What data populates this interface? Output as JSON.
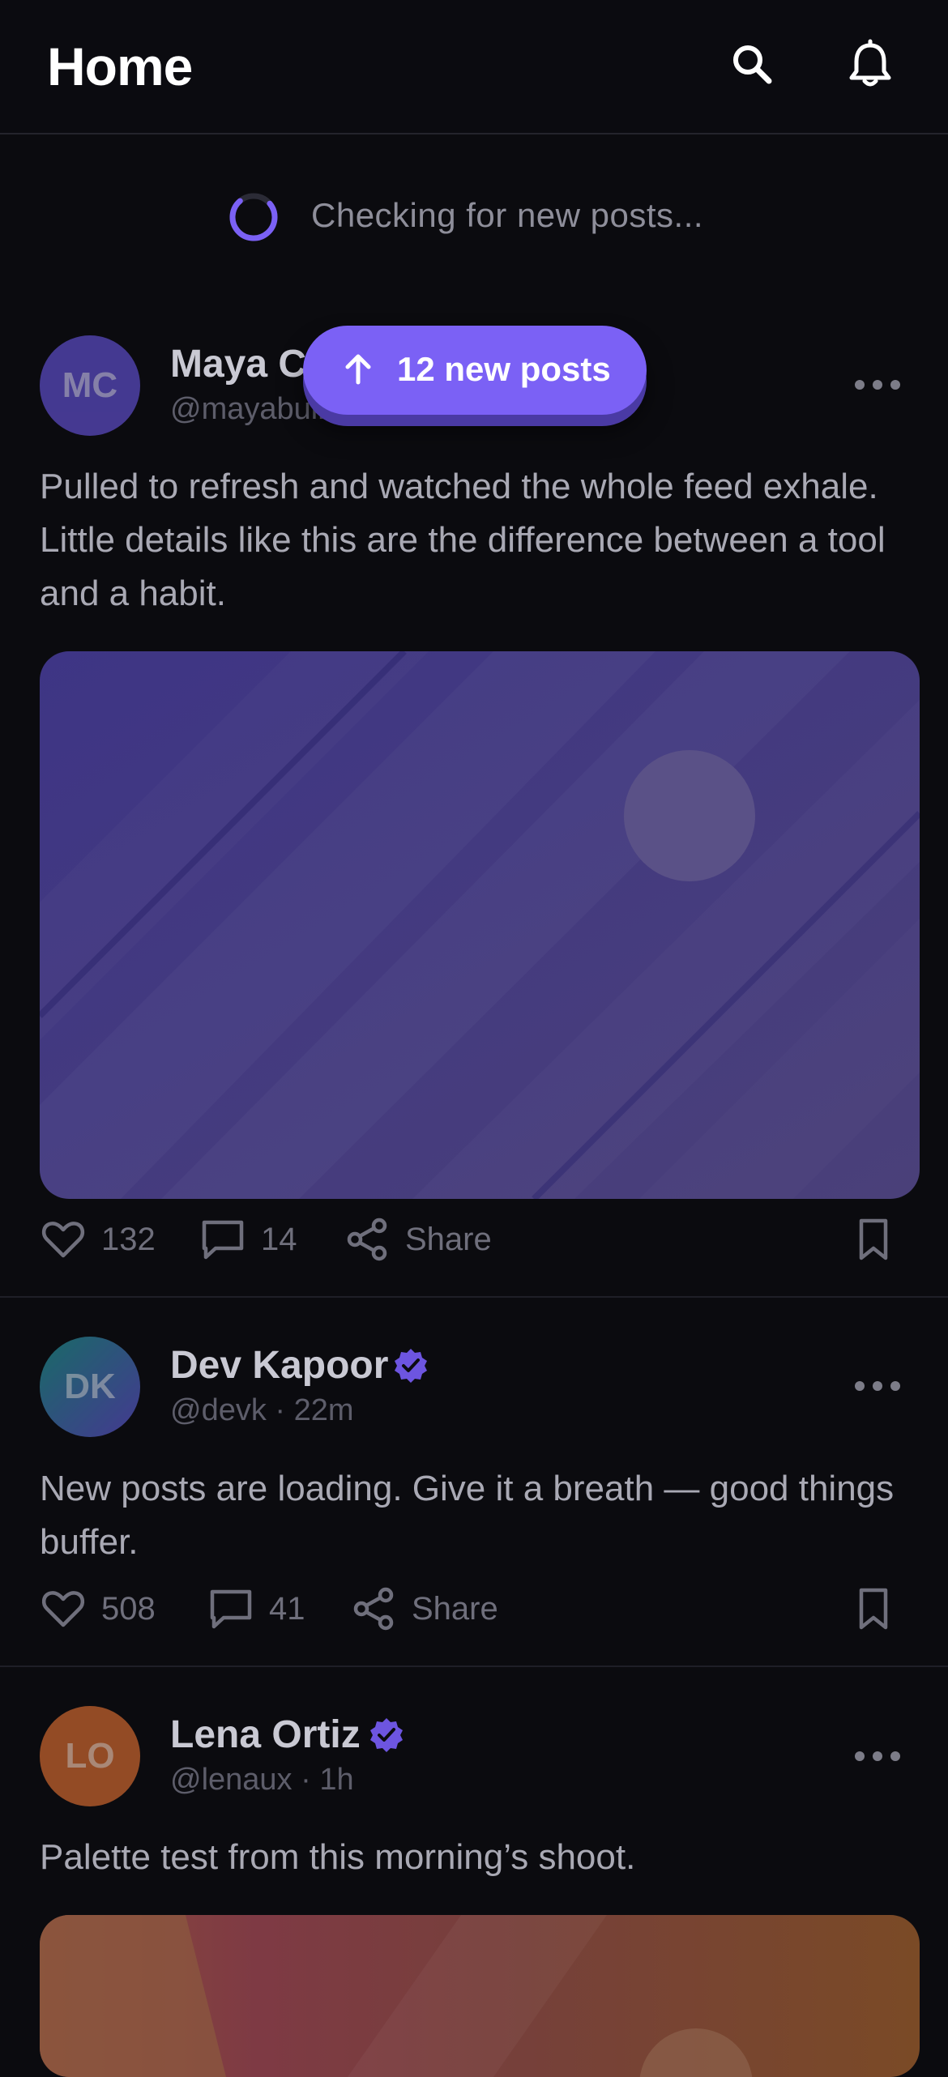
{
  "header": {
    "title": "Home",
    "search_icon": "search-icon",
    "bell_icon": "bell-icon"
  },
  "refresh": {
    "text": "Checking for new posts..."
  },
  "pill": {
    "label": "12 new posts",
    "icon": "arrow-up-icon",
    "color": "#7b61f5"
  },
  "posts": [
    {
      "initials": "MC",
      "name": "Maya C",
      "handle": "@mayabuilds · 1m",
      "body": "Pulled to refresh and watched the whole feed exhale. Little details like this are the difference between a tool and a habit.",
      "likes": "132",
      "comments": "14",
      "share": "Share"
    },
    {
      "initials": "DK",
      "name": "Dev Kapoor",
      "handle": "@devk · 22m",
      "body": "New posts are loading. Give it a breath — good things buffer.",
      "likes": "508",
      "comments": "41",
      "share": "Share"
    },
    {
      "initials": "LO",
      "name": "Lena Ortiz",
      "handle": "@lenaux · 1h",
      "body": "Palette test from this morning’s shoot."
    }
  ],
  "colors": {
    "accent": "#7b61f5",
    "background": "#0b0b0f",
    "verified": "#6d55e0"
  }
}
